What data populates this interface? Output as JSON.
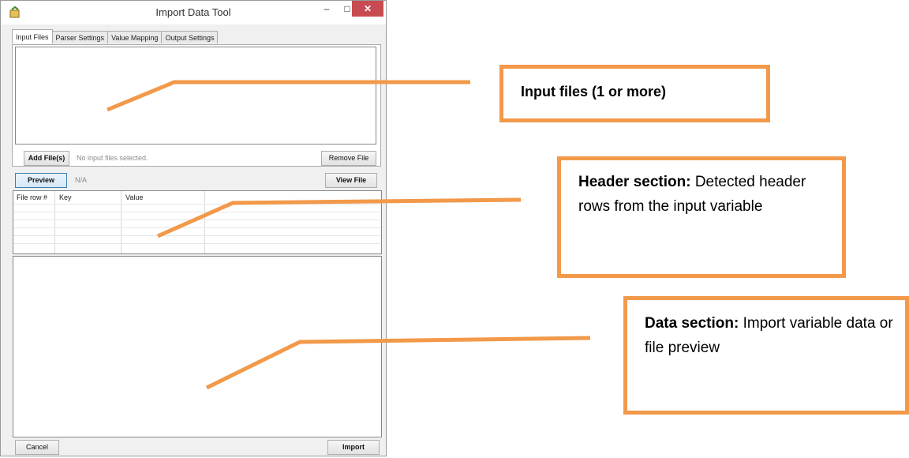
{
  "window": {
    "title": "Import Data Tool",
    "minimize_glyph": "–",
    "maximize_glyph": "□",
    "close_glyph": "✕",
    "app_icon": "import-app-icon"
  },
  "tabs": [
    {
      "label": "Input Files",
      "active": true
    },
    {
      "label": "Parser Settings",
      "active": false
    },
    {
      "label": "Value Mapping",
      "active": false
    },
    {
      "label": "Output Settings",
      "active": false
    }
  ],
  "input_files": {
    "add_label": "Add File(s)",
    "status": "No input files selected.",
    "remove_label": "Remove File"
  },
  "preview": {
    "preview_label": "Preview",
    "status": "N/A",
    "view_file_label": "View File"
  },
  "header_table": {
    "columns": [
      "File row #",
      "Key",
      "Value"
    ]
  },
  "footer": {
    "cancel_label": "Cancel",
    "import_label": "Import"
  },
  "annotations": {
    "input_files": "Input files (1 or more)",
    "header_title": "Header section:",
    "header_body": " Detected header rows from the input variable",
    "data_title": "Data section:",
    "data_body": " Import variable data or file preview"
  },
  "colors": {
    "annotation_orange": "#f2994a",
    "close_button_red": "#c74b50"
  }
}
